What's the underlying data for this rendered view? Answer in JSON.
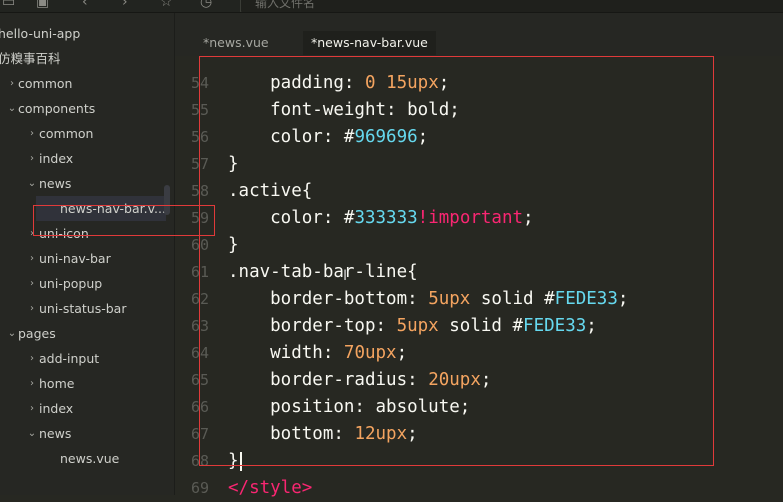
{
  "address_bar": {
    "placeholder": "输入文件名"
  },
  "sidebar": {
    "items": [
      {
        "label": "hello-uni-app",
        "arrow": ""
      },
      {
        "label": "仿糗事百科",
        "arrow": ""
      },
      {
        "label": "common",
        "arrow": "›"
      },
      {
        "label": "components",
        "arrow": "⌄"
      },
      {
        "label": "common",
        "arrow": "›"
      },
      {
        "label": "index",
        "arrow": "›"
      },
      {
        "label": "news",
        "arrow": "⌄"
      },
      {
        "label": "news-nav-bar.v...",
        "arrow": ""
      },
      {
        "label": "uni-icon",
        "arrow": "›"
      },
      {
        "label": "uni-nav-bar",
        "arrow": "›"
      },
      {
        "label": "uni-popup",
        "arrow": "›"
      },
      {
        "label": "uni-status-bar",
        "arrow": "›"
      },
      {
        "label": "pages",
        "arrow": "⌄"
      },
      {
        "label": "add-input",
        "arrow": "›"
      },
      {
        "label": "home",
        "arrow": "›"
      },
      {
        "label": "index",
        "arrow": "›"
      },
      {
        "label": "news",
        "arrow": "⌄"
      },
      {
        "label": "news.vue",
        "arrow": ""
      }
    ]
  },
  "tabs": [
    {
      "label": "*news.vue",
      "active": false
    },
    {
      "label": "*news-nav-bar.vue",
      "active": true
    }
  ],
  "editor": {
    "lines": [
      {
        "n": "54",
        "t": [
          [
            "prop",
            "    padding: "
          ],
          [
            "num",
            "0"
          ],
          [
            "punc",
            " "
          ],
          [
            "num",
            "15upx"
          ],
          [
            "punc",
            ";"
          ]
        ]
      },
      {
        "n": "55",
        "t": [
          [
            "prop",
            "    font-weight: bold;"
          ]
        ]
      },
      {
        "n": "56",
        "t": [
          [
            "prop",
            "    color: "
          ],
          [
            "hash",
            "#"
          ],
          [
            "hex",
            "969696"
          ],
          [
            "punc",
            ";"
          ]
        ]
      },
      {
        "n": "57",
        "t": [
          [
            "punc",
            "}"
          ]
        ]
      },
      {
        "n": "58",
        "t": [
          [
            "sel",
            ".active{"
          ]
        ]
      },
      {
        "n": "59",
        "t": [
          [
            "prop",
            "    color: "
          ],
          [
            "hash",
            "#"
          ],
          [
            "hex",
            "333333"
          ],
          [
            "imp",
            "!important"
          ],
          [
            "punc",
            ";"
          ]
        ]
      },
      {
        "n": "60",
        "t": [
          [
            "punc",
            "}"
          ]
        ]
      },
      {
        "n": "61",
        "t": [
          [
            "sel",
            ".nav-tab-bar-line{"
          ]
        ]
      },
      {
        "n": "62",
        "t": [
          [
            "prop",
            "    border-bottom: "
          ],
          [
            "num",
            "5upx"
          ],
          [
            "punc",
            " solid "
          ],
          [
            "hash",
            "#"
          ],
          [
            "hex",
            "FEDE33"
          ],
          [
            "punc",
            ";"
          ]
        ]
      },
      {
        "n": "63",
        "t": [
          [
            "prop",
            "    border-top: "
          ],
          [
            "num",
            "5upx"
          ],
          [
            "punc",
            " solid "
          ],
          [
            "hash",
            "#"
          ],
          [
            "hex",
            "FEDE33"
          ],
          [
            "punc",
            ";"
          ]
        ]
      },
      {
        "n": "64",
        "t": [
          [
            "prop",
            "    width: "
          ],
          [
            "num",
            "70upx"
          ],
          [
            "punc",
            ";"
          ]
        ]
      },
      {
        "n": "65",
        "t": [
          [
            "prop",
            "    border-radius: "
          ],
          [
            "num",
            "20upx"
          ],
          [
            "punc",
            ";"
          ]
        ]
      },
      {
        "n": "66",
        "t": [
          [
            "prop",
            "    position: absolute;"
          ]
        ]
      },
      {
        "n": "67",
        "t": [
          [
            "prop",
            "    bottom: "
          ],
          [
            "num",
            "12upx"
          ],
          [
            "punc",
            ";"
          ]
        ]
      },
      {
        "n": "68",
        "t": [
          [
            "punc",
            "}"
          ]
        ],
        "caret": true
      },
      {
        "n": "69",
        "t": [
          [
            "tag",
            "</style>"
          ]
        ]
      }
    ]
  },
  "colors": {
    "annotation_red": "#e03a3a",
    "number": "#f4a460",
    "hex": "#66d9ef",
    "keyword": "#f92672"
  },
  "icons": [
    "save-icon",
    "back-arrow-icon",
    "forward-arrow-icon",
    "star-icon",
    "history-icon",
    "search-icon"
  ]
}
